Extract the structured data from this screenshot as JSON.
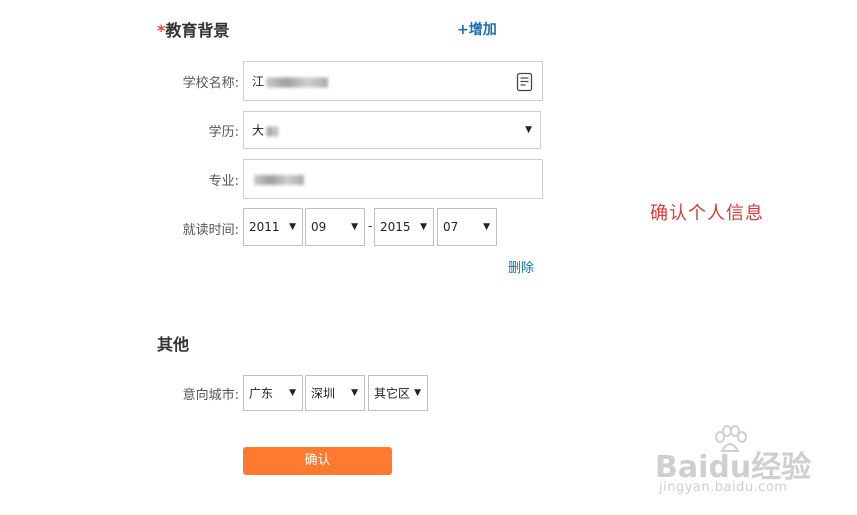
{
  "education": {
    "required_mark": "*",
    "title": "教育背景",
    "add_link": "+增加",
    "school": {
      "label": "学校名称:",
      "value_visible": "江"
    },
    "degree": {
      "label": "学历:",
      "value_visible": "大"
    },
    "major": {
      "label": "专业:",
      "value_visible": ""
    },
    "period": {
      "label": "就读时间:",
      "start_year": "2011",
      "start_month": "09",
      "separator": "-",
      "end_year": "2015",
      "end_month": "07"
    },
    "delete_link": "删除"
  },
  "annotation": "确认个人信息",
  "other": {
    "title": "其他",
    "city": {
      "label": "意向城市:",
      "province": "广东",
      "city": "深圳",
      "district": "其它区"
    }
  },
  "confirm_button": "确认",
  "watermark": {
    "brand": "Baidu经验",
    "url": "jingyan.baidu.com"
  },
  "colors": {
    "accent_orange": "#ff7a2e",
    "link_blue": "#1a6fb3",
    "required_red": "#e2463a",
    "note_red": "#d93a3a"
  },
  "icons": {
    "school_picker": "notepad-icon",
    "dropdown": "triangle-down-icon"
  }
}
